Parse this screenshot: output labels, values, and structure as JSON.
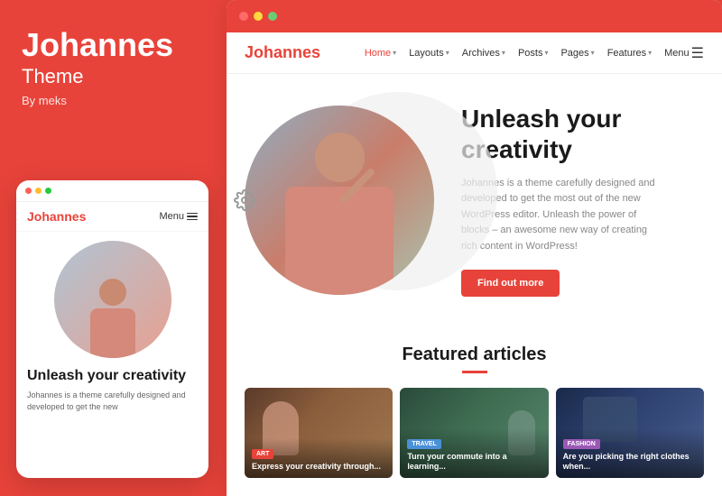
{
  "left_panel": {
    "brand_name": "Johannes",
    "brand_subtitle": "Theme",
    "brand_by": "By meks",
    "mobile_dots": [
      "red",
      "yellow",
      "green"
    ],
    "mobile_logo": "Johannes",
    "mobile_menu_label": "Menu",
    "mobile_hero_title": "Unleash your creativity",
    "mobile_hero_desc": "Johannes is a theme carefully designed and developed to get the new"
  },
  "right_panel": {
    "browser_dots": [
      "red",
      "yellow",
      "green"
    ],
    "nav": {
      "logo": "Johannes",
      "links": [
        {
          "label": "Home",
          "active": true,
          "has_dropdown": true
        },
        {
          "label": "Layouts",
          "has_dropdown": true
        },
        {
          "label": "Archives",
          "has_dropdown": true
        },
        {
          "label": "Posts",
          "has_dropdown": true
        },
        {
          "label": "Pages",
          "has_dropdown": true
        },
        {
          "label": "Features",
          "has_dropdown": true
        },
        {
          "label": "Menu",
          "has_hamburger": true
        }
      ]
    },
    "hero": {
      "title": "Unleash your creativity",
      "description": "Johannes is a theme carefully designed and developed to get the most out of the new WordPress editor. Unleash the power of blocks – an awesome new way of creating rich content in WordPress!",
      "button_label": "Find out more"
    },
    "featured": {
      "title": "Featured articles",
      "articles": [
        {
          "tag": "Art",
          "tag_type": "art",
          "title": "Express your creativity through..."
        },
        {
          "tag": "Travel",
          "tag_type": "travel",
          "title": "Turn your commute into a learning..."
        },
        {
          "tag": "Fashion",
          "tag_type": "fashion",
          "title": "Are you picking the right clothes when..."
        }
      ]
    }
  }
}
